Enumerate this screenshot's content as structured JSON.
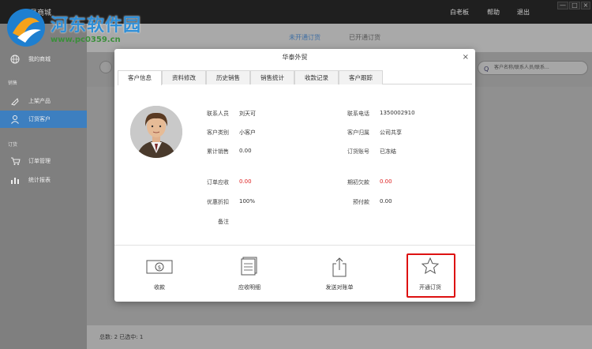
{
  "topbar": {
    "brand": "易商城",
    "menu": [
      "白老板",
      "帮助",
      "退出"
    ],
    "win_controls": [
      "—",
      "□",
      "×"
    ]
  },
  "watermark": {
    "site_name": "河东软件园",
    "url": "www.pc0359.cn"
  },
  "sidebar": {
    "items": [
      {
        "label": "我的商城",
        "icon": "globe-icon"
      },
      {
        "label": "上架产品",
        "icon": "tag-icon"
      },
      {
        "label": "订货客户",
        "icon": "user-icon"
      },
      {
        "label": "订单管理",
        "icon": "cart-icon"
      },
      {
        "label": "统计报表",
        "icon": "chart-icon"
      }
    ],
    "groups": [
      "销售",
      "订货"
    ]
  },
  "main": {
    "tabs": [
      "未开通订货",
      "已开通订货"
    ],
    "search_placeholder": "客户名称/联系人员/联系...",
    "footer": "总数: 2  已选中: 1"
  },
  "dialog": {
    "title": "华泰外贸",
    "close": "×",
    "tabs": [
      "客户信息",
      "资料修改",
      "历史销售",
      "销售统计",
      "收款记录",
      "客户跟踪"
    ],
    "fields_left": [
      {
        "label": "联系人员",
        "value": "刘天可"
      },
      {
        "label": "客户类别",
        "value": "小客户"
      },
      {
        "label": "累计销售",
        "value": "0.00"
      },
      {
        "label": "订单应收",
        "value": "0.00"
      },
      {
        "label": "优惠折扣",
        "value": "100%"
      },
      {
        "label": "备注",
        "value": ""
      }
    ],
    "fields_right": [
      {
        "label": "联系电话",
        "value": "1350002910"
      },
      {
        "label": "客户归属",
        "value": "公司共享"
      },
      {
        "label": "订货账号",
        "value": "已冻结"
      },
      {
        "label": "期初欠款",
        "value": "0.00"
      },
      {
        "label": "预付款",
        "value": "0.00"
      }
    ],
    "actions": [
      {
        "label": "收款",
        "icon": "money-icon"
      },
      {
        "label": "应收明细",
        "icon": "document-icon"
      },
      {
        "label": "发送对账单",
        "icon": "share-icon"
      },
      {
        "label": "开通订货",
        "icon": "star-icon"
      }
    ],
    "accent_red": "#d22222"
  }
}
